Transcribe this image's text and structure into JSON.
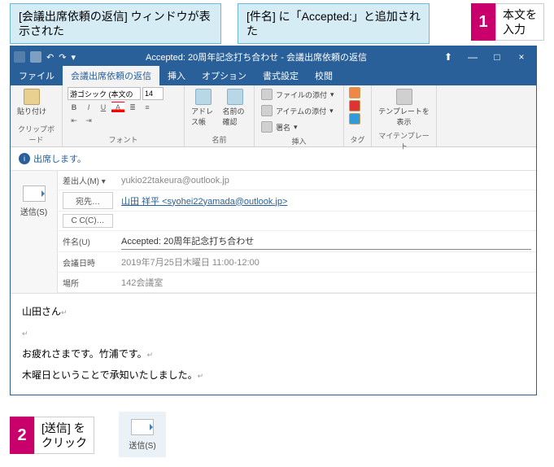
{
  "callouts": {
    "c1": "[会議出席依頼の返信] ウィンドウが表示された",
    "c2": "[件名] に「Accepted:」と追加された",
    "step1_num": "1",
    "step1_text": "本文を\n入力",
    "step2_num": "2",
    "step2_text": "[送信] を\nクリック"
  },
  "titlebar": {
    "title": "Accepted: 20周年記念打ち合わせ - 会議出席依頼の返信",
    "min": "—",
    "max": "□",
    "close": "×",
    "up": "⬆"
  },
  "tabs": {
    "file": "ファイル",
    "reply": "会議出席依頼の返信",
    "insert": "挿入",
    "option": "オプション",
    "format": "書式設定",
    "review": "校閲"
  },
  "ribbon": {
    "clipboard": {
      "paste": "貼り付け",
      "group": "クリップボード"
    },
    "font": {
      "name": "游ゴシック (本文の",
      "size": "14",
      "group": "フォント",
      "b": "B",
      "i": "I",
      "u": "U"
    },
    "names": {
      "addr": "アドレス帳",
      "check": "名前の確認",
      "group": "名前"
    },
    "include": {
      "attachfile": "ファイルの添付",
      "attachitem": "アイテムの添付",
      "sign": "署名",
      "group": "挿入"
    },
    "tags": {
      "flag": "▸",
      "group": "タグ"
    },
    "template": {
      "view": "テンプレートを表示",
      "group": "マイテンプレート"
    }
  },
  "info": {
    "text": "出席します。"
  },
  "fields": {
    "from_label": "差出人(M)",
    "from_val": "yukio22takeura@outlook.jp",
    "to_label": "宛先…",
    "to_val": "山田 祥平 <syohei22yamada@outlook.jp>",
    "cc_label": "C C(C)…",
    "cc_val": "",
    "subj_label": "件名(U)",
    "subj_val": "Accepted: 20周年記念打ち合わせ",
    "when_label": "会議日時",
    "when_val": "2019年7月25日木曜日 11:00-12:00",
    "where_label": "場所",
    "where_val": "142会議室"
  },
  "send": {
    "label": "送信(S)"
  },
  "body": {
    "l1": "山田さん",
    "l2": "",
    "l3": "お疲れさまです。竹浦です。",
    "l4": "木曜日ということで承知いたしました。"
  }
}
